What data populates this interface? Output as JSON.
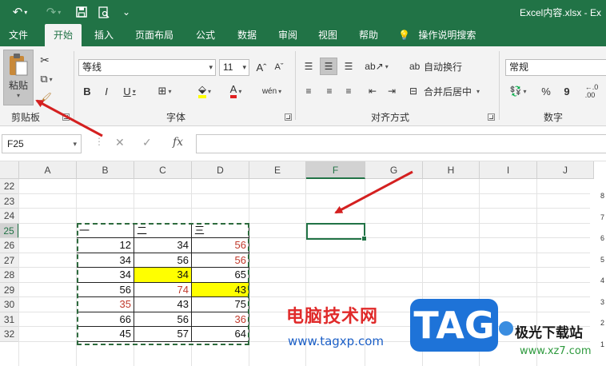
{
  "titlebar": {
    "document_title": "Excel内容.xlsx  -  Ex",
    "undo_icon": "↶",
    "redo_icon": "↷",
    "save_icon": "🖫",
    "preview_icon": "🗋",
    "customize_icon": "⌄"
  },
  "tabs": [
    "文件",
    "开始",
    "插入",
    "页面布局",
    "公式",
    "数据",
    "审阅",
    "视图",
    "帮助",
    "操作说明搜索"
  ],
  "ribbon": {
    "clipboard": {
      "paste_label": "粘贴",
      "group_label": "剪贴板"
    },
    "font": {
      "font_name": "等线",
      "font_size": "11",
      "grow": "Aˆ",
      "shrink": "Aˇ",
      "bold": "B",
      "italic": "I",
      "underline": "U",
      "phonetic": "wén",
      "group_label": "字体"
    },
    "alignment": {
      "wrap_text": "自动换行",
      "merge_center": "合并后居中",
      "group_label": "对齐方式"
    },
    "number": {
      "format": "常规",
      "currency": "💱",
      "percent": "%",
      "comma": "9",
      "group_label": "数字"
    }
  },
  "formula_bar": {
    "name_box": "F25",
    "cancel": "✕",
    "enter": "✓",
    "fx": "fx",
    "formula": ""
  },
  "columns": [
    "A",
    "B",
    "C",
    "D",
    "E",
    "F",
    "G",
    "H",
    "I",
    "J"
  ],
  "rows": [
    "22",
    "23",
    "24",
    "25",
    "26",
    "27",
    "28",
    "29",
    "30",
    "31",
    "32"
  ],
  "table": {
    "headers": [
      "一",
      "二",
      "三"
    ],
    "rows": [
      [
        "12",
        "34",
        "56"
      ],
      [
        "34",
        "56",
        "56"
      ],
      [
        "34",
        "34",
        "65"
      ],
      [
        "56",
        "74",
        "43"
      ],
      [
        "35",
        "43",
        "75"
      ],
      [
        "66",
        "56",
        "36"
      ],
      [
        "45",
        "57",
        "64"
      ]
    ]
  },
  "side_numbers": [
    "8",
    "7",
    "6",
    "5",
    "4",
    "3",
    "2",
    "1"
  ],
  "watermark": {
    "cn_text": "电脑技术网",
    "url": "www.tagxp.com",
    "tag": "TAG",
    "site_name": "极光下载站",
    "site_url": "www.xz7.com"
  },
  "colors": {
    "excel_green": "#217346",
    "red_text": "#c0392b",
    "highlight": "#ffff00",
    "arrow": "#d42020"
  }
}
